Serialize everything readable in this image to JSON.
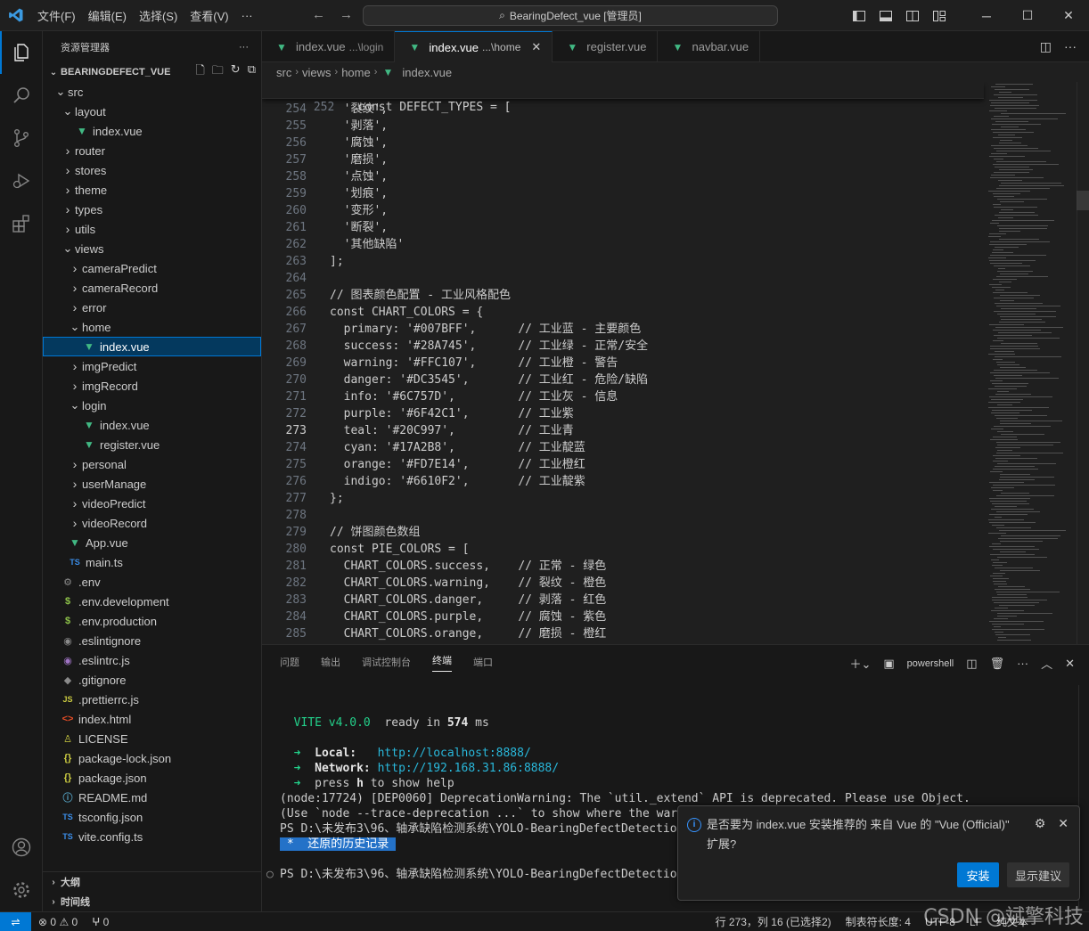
{
  "titlebar": {
    "menu": [
      "文件(F)",
      "编辑(E)",
      "选择(S)",
      "查看(V)",
      "···"
    ],
    "search": "BearingDefect_vue [管理员]"
  },
  "sidebar": {
    "title": "资源管理器",
    "project": "BEARINGDEFECT_VUE",
    "tree": [
      {
        "label": "src",
        "depth": 1,
        "type": "folder-open"
      },
      {
        "label": "layout",
        "depth": 2,
        "type": "folder-open"
      },
      {
        "label": "index.vue",
        "depth": 3,
        "type": "vue"
      },
      {
        "label": "router",
        "depth": 2,
        "type": "folder"
      },
      {
        "label": "stores",
        "depth": 2,
        "type": "folder"
      },
      {
        "label": "theme",
        "depth": 2,
        "type": "folder"
      },
      {
        "label": "types",
        "depth": 2,
        "type": "folder"
      },
      {
        "label": "utils",
        "depth": 2,
        "type": "folder"
      },
      {
        "label": "views",
        "depth": 2,
        "type": "folder-open"
      },
      {
        "label": "cameraPredict",
        "depth": 3,
        "type": "folder"
      },
      {
        "label": "cameraRecord",
        "depth": 3,
        "type": "folder"
      },
      {
        "label": "error",
        "depth": 3,
        "type": "folder"
      },
      {
        "label": "home",
        "depth": 3,
        "type": "folder-open"
      },
      {
        "label": "index.vue",
        "depth": 4,
        "type": "vue",
        "selected": true
      },
      {
        "label": "imgPredict",
        "depth": 3,
        "type": "folder"
      },
      {
        "label": "imgRecord",
        "depth": 3,
        "type": "folder"
      },
      {
        "label": "login",
        "depth": 3,
        "type": "folder-open"
      },
      {
        "label": "index.vue",
        "depth": 4,
        "type": "vue"
      },
      {
        "label": "register.vue",
        "depth": 4,
        "type": "vue"
      },
      {
        "label": "personal",
        "depth": 3,
        "type": "folder"
      },
      {
        "label": "userManage",
        "depth": 3,
        "type": "folder"
      },
      {
        "label": "videoPredict",
        "depth": 3,
        "type": "folder"
      },
      {
        "label": "videoRecord",
        "depth": 3,
        "type": "folder"
      },
      {
        "label": "App.vue",
        "depth": 2,
        "type": "vue"
      },
      {
        "label": "main.ts",
        "depth": 2,
        "type": "ts"
      },
      {
        "label": ".env",
        "depth": 1,
        "type": "gear"
      },
      {
        "label": ".env.development",
        "depth": 1,
        "type": "dollar"
      },
      {
        "label": ".env.production",
        "depth": 1,
        "type": "dollar"
      },
      {
        "label": ".eslintignore",
        "depth": 1,
        "type": "circle"
      },
      {
        "label": ".eslintrc.js",
        "depth": 1,
        "type": "eslint"
      },
      {
        "label": ".gitignore",
        "depth": 1,
        "type": "git"
      },
      {
        "label": ".prettierrc.js",
        "depth": 1,
        "type": "js"
      },
      {
        "label": "index.html",
        "depth": 1,
        "type": "html"
      },
      {
        "label": "LICENSE",
        "depth": 1,
        "type": "license"
      },
      {
        "label": "package-lock.json",
        "depth": 1,
        "type": "json"
      },
      {
        "label": "package.json",
        "depth": 1,
        "type": "json"
      },
      {
        "label": "README.md",
        "depth": 1,
        "type": "info"
      },
      {
        "label": "tsconfig.json",
        "depth": 1,
        "type": "tsconfig"
      },
      {
        "label": "vite.config.ts",
        "depth": 1,
        "type": "ts"
      }
    ],
    "outline": "大纲",
    "timeline": "时间线"
  },
  "tabs": [
    {
      "name": "index.vue",
      "desc": "...\\login",
      "active": false
    },
    {
      "name": "index.vue",
      "desc": "...\\home",
      "active": true
    },
    {
      "name": "register.vue",
      "desc": "",
      "active": false
    },
    {
      "name": "navbar.vue",
      "desc": "",
      "active": false
    }
  ],
  "breadcrumb": [
    "src",
    "views",
    "home",
    "index.vue"
  ],
  "editor": {
    "sticky": {
      "num": "252",
      "text": "const DEFECT_TYPES = ["
    },
    "current_line": "273",
    "lines": [
      {
        "num": "254",
        "text": "  '裂纹',"
      },
      {
        "num": "255",
        "text": "  '剥落',"
      },
      {
        "num": "256",
        "text": "  '腐蚀',"
      },
      {
        "num": "257",
        "text": "  '磨损',"
      },
      {
        "num": "258",
        "text": "  '点蚀',"
      },
      {
        "num": "259",
        "text": "  '划痕',"
      },
      {
        "num": "260",
        "text": "  '变形',"
      },
      {
        "num": "261",
        "text": "  '断裂',"
      },
      {
        "num": "262",
        "text": "  '其他缺陷'"
      },
      {
        "num": "263",
        "text": "];"
      },
      {
        "num": "264",
        "text": ""
      },
      {
        "num": "265",
        "text": "// 图表颜色配置 - 工业风格配色"
      },
      {
        "num": "266",
        "text": "const CHART_COLORS = {"
      },
      {
        "num": "267",
        "text": "  primary: '#007BFF',      // 工业蓝 - 主要颜色"
      },
      {
        "num": "268",
        "text": "  success: '#28A745',      // 工业绿 - 正常/安全"
      },
      {
        "num": "269",
        "text": "  warning: '#FFC107',      // 工业橙 - 警告"
      },
      {
        "num": "270",
        "text": "  danger: '#DC3545',       // 工业红 - 危险/缺陷"
      },
      {
        "num": "271",
        "text": "  info: '#6C757D',         // 工业灰 - 信息"
      },
      {
        "num": "272",
        "text": "  purple: '#6F42C1',       // 工业紫"
      },
      {
        "num": "273",
        "text": "  teal: '#20C997',         // 工业青"
      },
      {
        "num": "274",
        "text": "  cyan: '#17A2B8',         // 工业靛蓝"
      },
      {
        "num": "275",
        "text": "  orange: '#FD7E14',       // 工业橙红"
      },
      {
        "num": "276",
        "text": "  indigo: '#6610F2',       // 工业靛紫"
      },
      {
        "num": "277",
        "text": "};"
      },
      {
        "num": "278",
        "text": ""
      },
      {
        "num": "279",
        "text": "// 饼图颜色数组"
      },
      {
        "num": "280",
        "text": "const PIE_COLORS = ["
      },
      {
        "num": "281",
        "text": "  CHART_COLORS.success,    // 正常 - 绿色"
      },
      {
        "num": "282",
        "text": "  CHART_COLORS.warning,    // 裂纹 - 橙色"
      },
      {
        "num": "283",
        "text": "  CHART_COLORS.danger,     // 剥落 - 红色"
      },
      {
        "num": "284",
        "text": "  CHART_COLORS.purple,     // 腐蚀 - 紫色"
      },
      {
        "num": "285",
        "text": "  CHART_COLORS.orange,     // 磨损 - 橙红"
      }
    ]
  },
  "panel": {
    "tabs": [
      "问题",
      "输出",
      "调试控制台",
      "终端",
      "端口"
    ],
    "active_tab": "终端",
    "shell": "powershell",
    "terminal": {
      "vite": "VITE v4.0.0",
      "ready": "ready in",
      "ms_value": "574",
      "ms_unit": "ms",
      "local_label": "Local:",
      "local_url": "http://localhost:8888/",
      "network_label": "Network:",
      "network_url": "http://192.168.31.86:8888/",
      "help_pre": "press",
      "help_key": "h",
      "help_post": "to show help",
      "warn1": "(node:17724) [DEP0060] DeprecationWarning: The `util._extend` API is deprecated. Please use Object.",
      "warn2": "(Use `node --trace-deprecation ...` to show where the warning was created)",
      "ps1": "PS D:\\未发布3\\96、轴承缺陷检测系统\\YOLO-BearingDefectDetection\\E",
      "restored": " *  还原的历史记录 ",
      "ps2": "PS D:\\未发布3\\96、轴承缺陷检测系统\\YOLO-BearingDefectDetection\\E"
    }
  },
  "notification": {
    "message": "是否要为 index.vue 安装推荐的 来自 Vue 的 \"Vue (Official)\" 扩展?",
    "install": "安装",
    "show": "显示建议"
  },
  "statusbar": {
    "errors": "0",
    "warnings": "0",
    "ports": "0",
    "position": "行 273，列 16 (已选择2)",
    "tab": "制表符长度: 4",
    "encoding": "UTF-8",
    "eol": "LF",
    "lang": "纯文本"
  },
  "watermark": "CSDN @斌擎科技",
  "colors": {
    "accent": "#0078d4",
    "vue": "#41b883",
    "selection": "#04395e"
  }
}
